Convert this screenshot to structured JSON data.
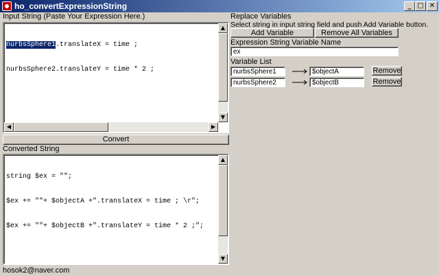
{
  "window": {
    "title": "ho_convertExpressionString",
    "minimize_glyph": "_",
    "maximize_glyph": "□",
    "close_glyph": "✕"
  },
  "input": {
    "label": "Input String (Paste Your Expression Here.)",
    "selected_text": "nurbsSphere1",
    "line1_rest": ".translateX = time ;",
    "line2": "nurbsSphere2.translateY = time * 2 ;"
  },
  "convert_button": "Convert",
  "output": {
    "label": "Converted String",
    "lines": [
      "string $ex = \"\";",
      "$ex += \"\"+ $objectA +\".translateX = time ; \\r\";",
      "$ex += \"\"+ $objectB +\".translateY = time * 2 ;\";"
    ]
  },
  "replace": {
    "label": "Replace Variables",
    "instruction": "Select string in input string field and push Add Variable button.",
    "add_button": "Add Variable",
    "remove_all_button": "Remove All Variables",
    "var_name_label": "Expression String Variable Name",
    "var_name_value": "ex",
    "list_label": "Variable List",
    "variables": [
      {
        "source": "nurbsSphere1",
        "target": "$objectA",
        "remove": "Remove"
      },
      {
        "source": "nurbsSphere2",
        "target": "$objectB",
        "remove": "Remove"
      }
    ]
  },
  "status": "hosok2@naver.com",
  "icons": {
    "scroll_up": "▲",
    "scroll_down": "▼",
    "scroll_left": "◀",
    "scroll_right": "▶"
  }
}
